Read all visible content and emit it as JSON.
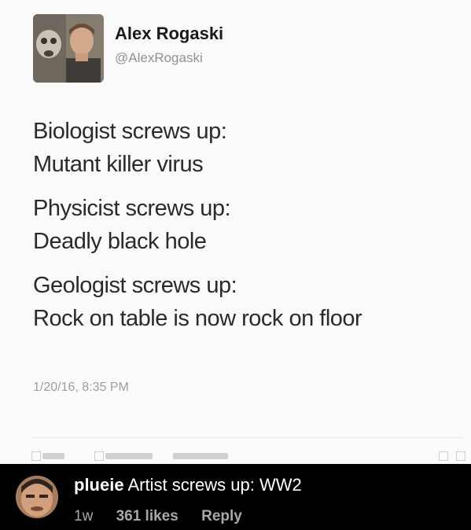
{
  "tweet": {
    "author_name": "Alex Rogaski",
    "author_handle": "@AlexRogaski",
    "paragraphs": [
      [
        "Biologist screws up:",
        "Mutant killer virus"
      ],
      [
        "Physicist screws up:",
        "Deadly black hole"
      ],
      [
        "Geologist screws up:",
        "Rock on table is now rock on floor"
      ]
    ],
    "timestamp": "1/20/16, 8:35 PM"
  },
  "comment": {
    "username": "plueie",
    "text": "Artist screws up: WW2",
    "age": "1w",
    "likes": "361 likes",
    "reply_label": "Reply"
  },
  "icons": {
    "tweet_avatar": "profile-photo-icon",
    "comment_avatar": "profile-photo-icon"
  }
}
